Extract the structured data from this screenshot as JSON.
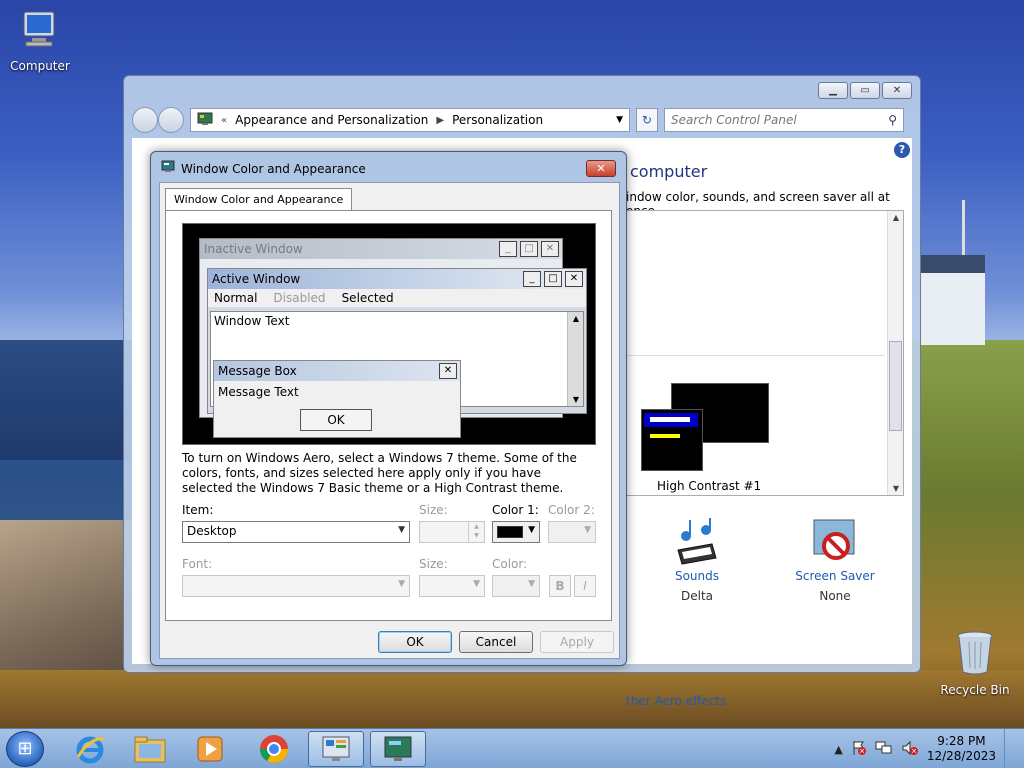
{
  "desktop": {
    "icons": [
      {
        "label": "Computer",
        "icon": "computer-icon"
      },
      {
        "label": "Recycle Bin",
        "icon": "recycle-bin-icon"
      }
    ]
  },
  "control_panel": {
    "breadcrumb": {
      "overflow": "«",
      "items": [
        "Appearance and Personalization",
        "Personalization"
      ]
    },
    "search_placeholder": "Search Control Panel",
    "heading_partial": "computer",
    "sub_partial": "indow color, sounds, and screen saver all at once.",
    "theme_label": "High Contrast #1",
    "items": [
      {
        "label": "Sounds",
        "value": "Delta",
        "icon": "sounds-icon"
      },
      {
        "label": "Screen Saver",
        "value": "None",
        "icon": "screen-saver-icon"
      }
    ],
    "aero_link_partial": "ther Aero effects"
  },
  "dialog": {
    "title": "Window Color and Appearance",
    "tab": "Window Color and Appearance",
    "preview": {
      "inactive_title": "Inactive Window",
      "active_title": "Active Window",
      "menu": [
        "Normal",
        "Disabled",
        "Selected"
      ],
      "window_text": "Window Text",
      "msgbox_title": "Message Box",
      "msgbox_text": "Message Text",
      "ok": "OK"
    },
    "note": "To turn on Windows Aero, select a Windows 7 theme.  Some of the colors, fonts, and sizes selected here apply only if you have selected the Windows 7 Basic theme or a High Contrast theme.",
    "labels": {
      "item": "Item:",
      "size": "Size:",
      "color1": "Color 1:",
      "color2": "Color 2:",
      "font": "Font:",
      "size2": "Size:",
      "color": "Color:"
    },
    "item_value": "Desktop",
    "color1_value": "#000000",
    "bold": "B",
    "italic": "I",
    "buttons": {
      "ok": "OK",
      "cancel": "Cancel",
      "apply": "Apply"
    }
  },
  "taskbar": {
    "start_glyph": "⊞",
    "pinned": [
      "internet-explorer-icon",
      "windows-explorer-icon",
      "media-player-icon",
      "chrome-icon",
      "control-panel-icon",
      "personalization-icon"
    ],
    "time": "9:28 PM",
    "date": "12/28/2023",
    "tray_arrow": "▲"
  }
}
